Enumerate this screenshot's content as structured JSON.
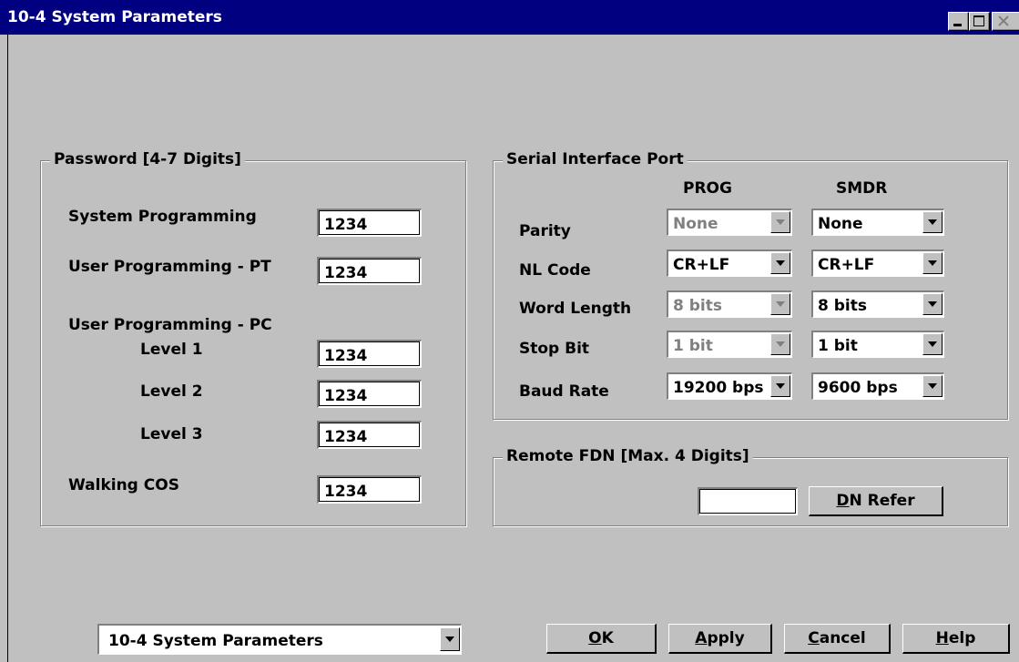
{
  "window": {
    "title": "10-4 System Parameters",
    "controls": [
      "minimize-icon",
      "maximize-icon",
      "close-icon"
    ]
  },
  "password_group": {
    "title": "Password [4-7 Digits]",
    "system_programming": {
      "label": "System Programming",
      "value": "1234"
    },
    "user_programming_pt": {
      "label": "User Programming - PT",
      "value": "1234"
    },
    "user_programming_pc": {
      "label": "User Programming - PC",
      "level1": {
        "label": "Level 1",
        "value": "1234"
      },
      "level2": {
        "label": "Level 2",
        "value": "1234"
      },
      "level3": {
        "label": "Level 3",
        "value": "1234"
      }
    },
    "walking_cos": {
      "label": "Walking COS",
      "value": "1234"
    }
  },
  "serial_group": {
    "title": "Serial Interface Port",
    "col_prog": "PROG",
    "col_smdr": "SMDR",
    "rows": [
      {
        "label": "Parity",
        "prog": "None",
        "smdr": "None",
        "prog_disabled": true
      },
      {
        "label": "NL Code",
        "prog": "CR+LF",
        "smdr": "CR+LF",
        "prog_disabled": false
      },
      {
        "label": "Word Length",
        "prog": "8 bits",
        "smdr": "8 bits",
        "prog_disabled": true
      },
      {
        "label": "Stop Bit",
        "prog": "1 bit",
        "smdr": "1 bit",
        "prog_disabled": true
      },
      {
        "label": "Baud Rate",
        "prog": "19200 bps",
        "smdr": "9600 bps",
        "prog_disabled": false
      }
    ]
  },
  "remote_fdn_group": {
    "title": "Remote FDN [Max. 4 Digits]",
    "value": "",
    "dn_refer_label_mnemonic": "D",
    "dn_refer_label_rest": "N Refer"
  },
  "footer": {
    "page_select": "10-4 System Parameters",
    "ok": {
      "mnemonic": "O",
      "rest": "K"
    },
    "apply": {
      "mnemonic": "A",
      "rest": "pply"
    },
    "cancel": {
      "mnemonic": "C",
      "rest": "ancel"
    },
    "help": {
      "mnemonic": "H",
      "rest": "elp"
    }
  },
  "colors": {
    "titlebar": "#000080",
    "face": "#c0c0c0",
    "disabled_text": "#808080"
  }
}
